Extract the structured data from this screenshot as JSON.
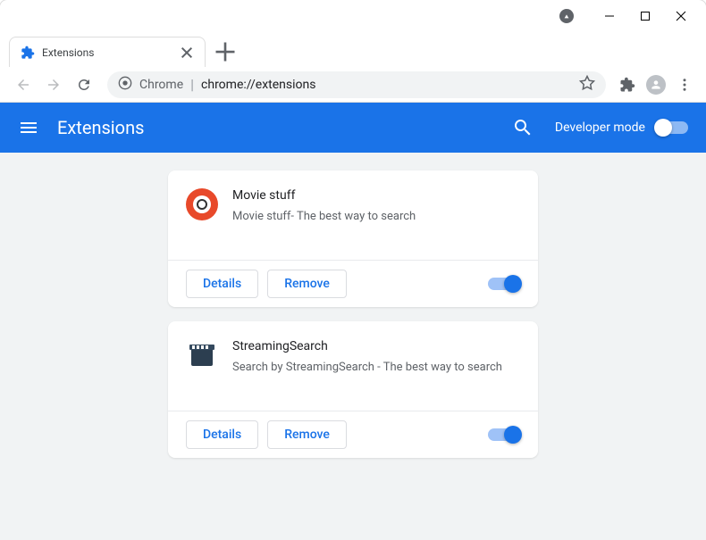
{
  "window": {
    "tab": {
      "title": "Extensions"
    },
    "addressbar": {
      "protocol": "Chrome",
      "url": "chrome://extensions"
    }
  },
  "header": {
    "title": "Extensions",
    "dev_mode_label": "Developer mode"
  },
  "extensions": [
    {
      "name": "Movie stuff",
      "description": "Movie stuff- The best way to search",
      "details_label": "Details",
      "remove_label": "Remove",
      "enabled": true
    },
    {
      "name": "StreamingSearch",
      "description": "Search by StreamingSearch - The best way to search",
      "details_label": "Details",
      "remove_label": "Remove",
      "enabled": true
    }
  ]
}
